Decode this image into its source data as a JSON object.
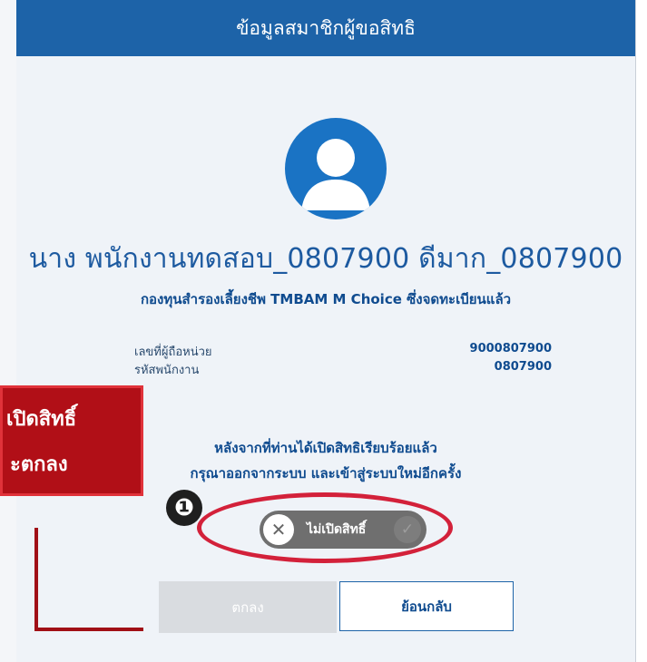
{
  "header": {
    "title": "ข้อมูลสมาชิกผู้ขอสิทธิ"
  },
  "member": {
    "name": "นาง พนักงานทดสอบ_0807900 ดีมาก_0807900",
    "fund": "กองทุนสำรองเลี้ยงชีพ TMBAM M Choice ซึ่งจดทะเบียนแล้ว"
  },
  "details": [
    {
      "label": "เลขที่ผู้ถือหน่วย",
      "value": "9000807900"
    },
    {
      "label": "รหัสพนักงาน",
      "value": "0807900"
    }
  ],
  "notice": {
    "line1": "หลังจากที่ท่านได้เปิดสิทธิเรียบร้อยแล้ว",
    "line2": "กรุณาออกจากระบบ และเข้าสู่ระบบใหม่อีกครั้ง"
  },
  "toggle": {
    "label": "ไม่เปิดสิทธิ์",
    "state": "off",
    "off_icon": "x-icon",
    "on_icon": "check-icon"
  },
  "annotation": {
    "step": "❶",
    "callout_line1": "เปิดสิทธิ์",
    "callout_line2": "ะตกลง"
  },
  "buttons": {
    "ok": "ตกลง",
    "back": "ย้อนกลับ"
  },
  "colors": {
    "header": "#1d63a8",
    "accent_text": "#0f4b8f",
    "annotation_red": "#d3213a",
    "callout_red": "#b10f17",
    "toggle_off": "#6f6f6f"
  }
}
